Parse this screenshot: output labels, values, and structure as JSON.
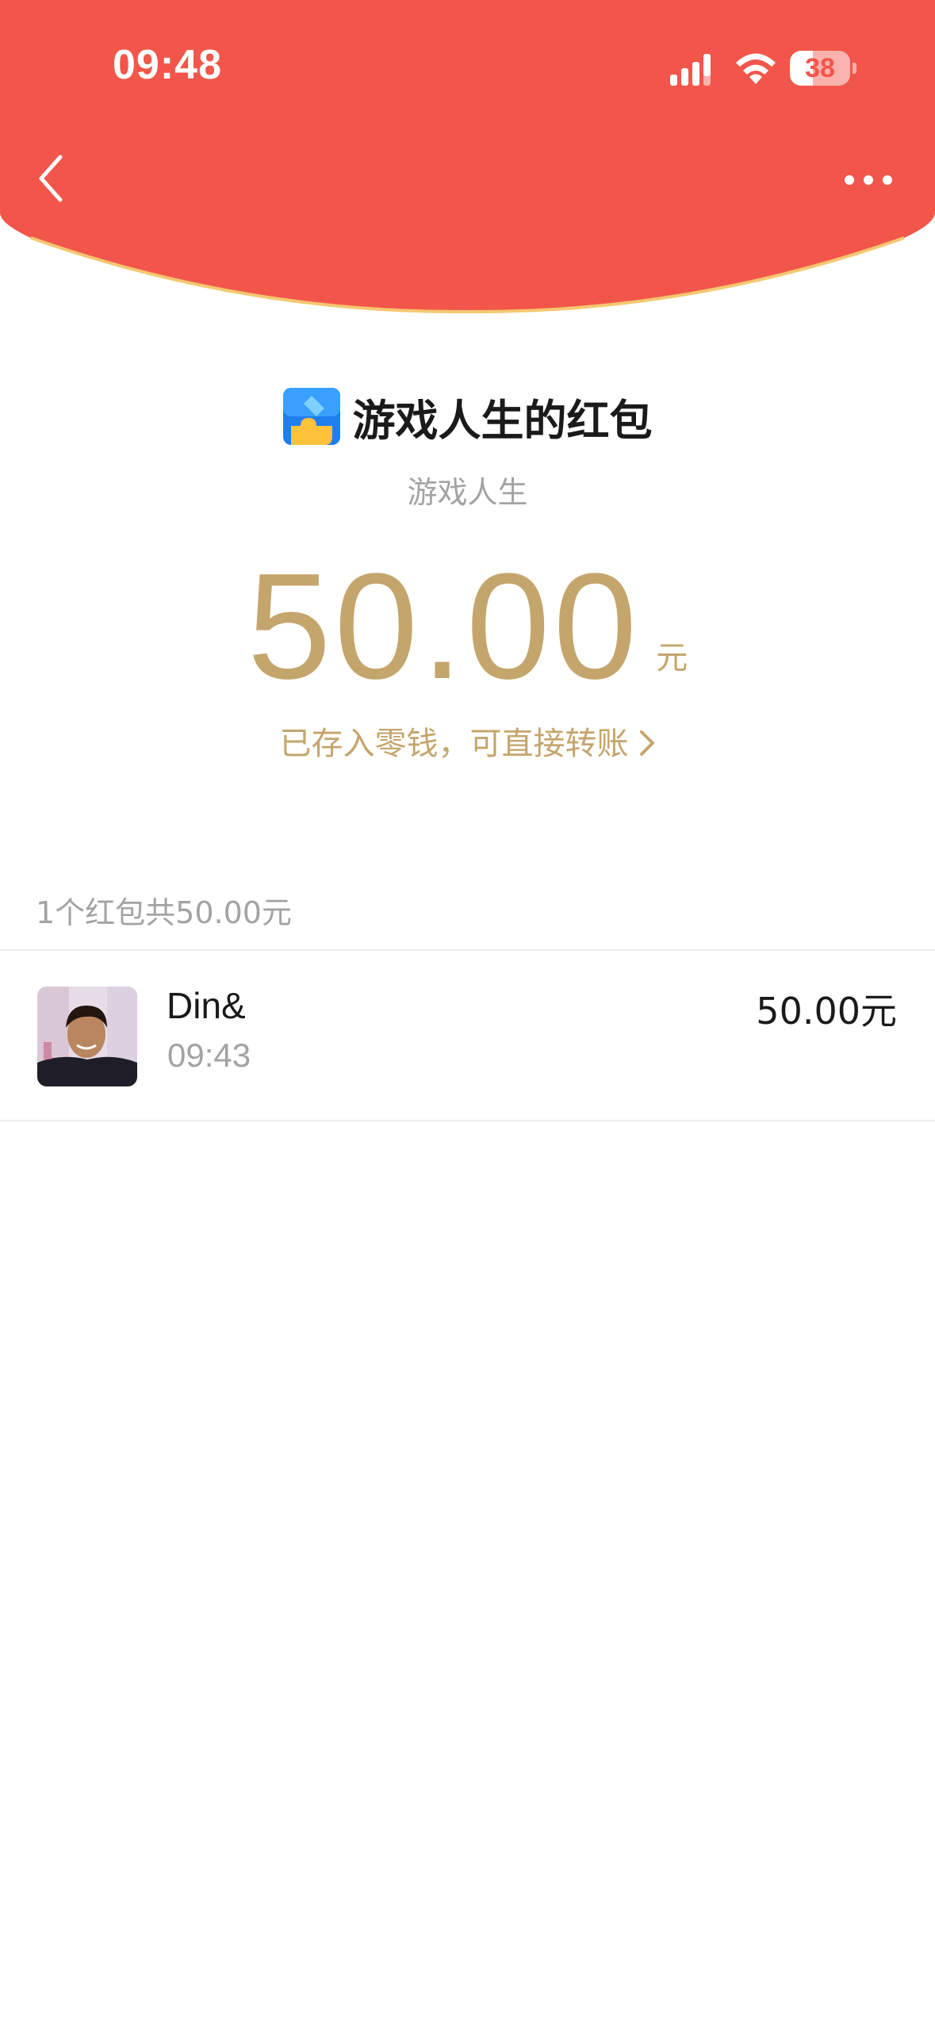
{
  "status_bar": {
    "time": "09:48",
    "battery": "38",
    "battery_level": 0.38
  },
  "header": {
    "background_color": "#f2564a",
    "curve_edge_color": "#f5c770"
  },
  "sender": {
    "title": "游戏人生的红包",
    "subtitle": "游戏人生",
    "app_icon": "puzzle-app-icon"
  },
  "amount": {
    "value": "50.00",
    "unit": "元",
    "color": "#c4a56c"
  },
  "stored_link": {
    "label": "已存入零钱，可直接转账"
  },
  "summary": {
    "text": "1个红包共50.00元"
  },
  "records": [
    {
      "name": "Din&",
      "time": "09:43",
      "amount": "50.00元"
    }
  ]
}
